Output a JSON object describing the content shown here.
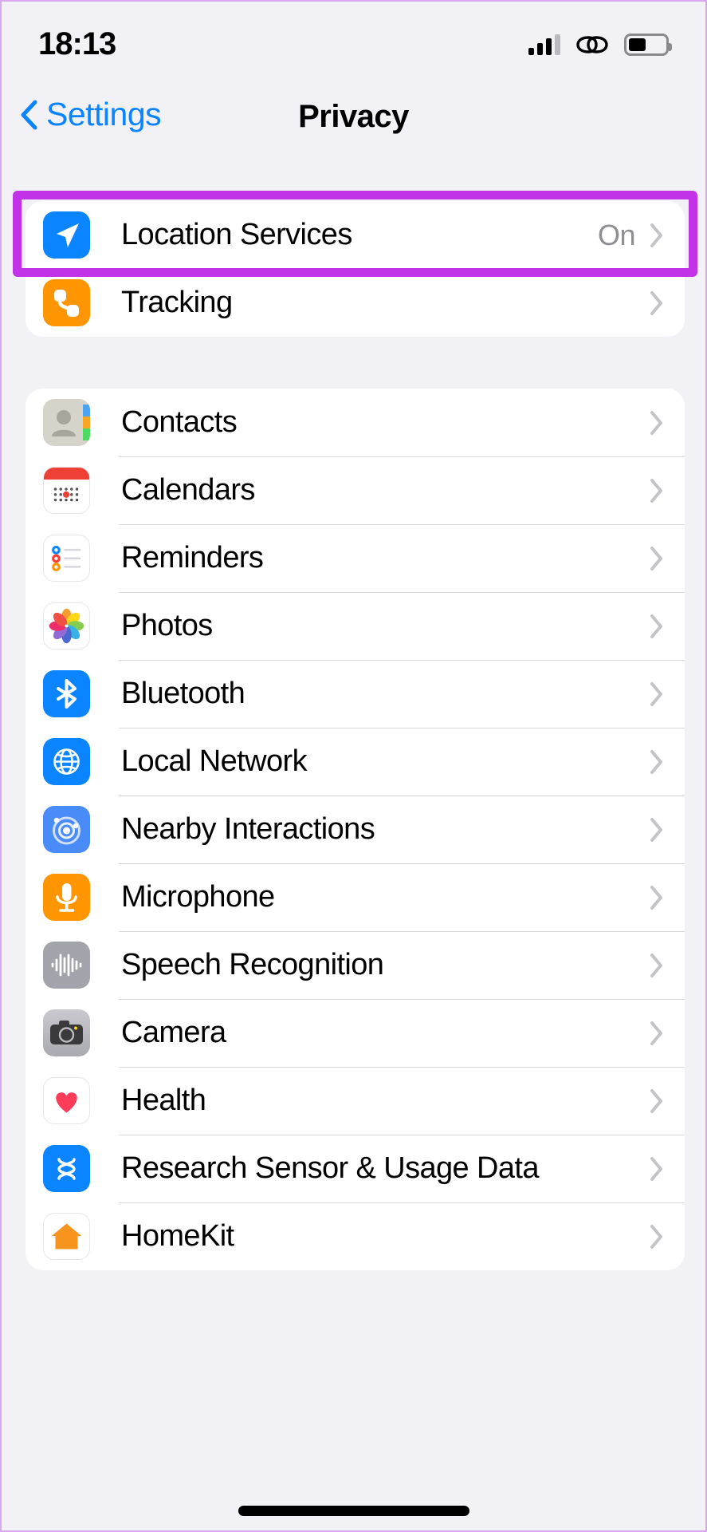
{
  "status_bar": {
    "time": "18:13",
    "signal_icon": "cellular-signal-icon",
    "link_icon": "chain-link-icon",
    "battery_icon": "battery-icon",
    "battery_level_pct": 48
  },
  "nav": {
    "back_label": "Settings",
    "back_icon": "chevron-left-icon",
    "title": "Privacy"
  },
  "colors": {
    "accent_blue": "#0a84ff",
    "highlight_purple": "#c233e8",
    "background": "#f2f1f6",
    "card": "#ffffff",
    "value_gray": "#8e8e93",
    "orange": "#ff9500"
  },
  "groups": [
    {
      "name": "primary",
      "rows": [
        {
          "label": "Location Services",
          "value": "On",
          "icon": "location-arrow-icon",
          "highlighted": true
        },
        {
          "label": "Tracking",
          "value": "",
          "icon": "tracking-icon",
          "highlighted": false
        }
      ]
    },
    {
      "name": "permissions",
      "rows": [
        {
          "label": "Contacts",
          "value": "",
          "icon": "contacts-icon",
          "highlighted": false
        },
        {
          "label": "Calendars",
          "value": "",
          "icon": "calendar-icon",
          "highlighted": false
        },
        {
          "label": "Reminders",
          "value": "",
          "icon": "reminders-icon",
          "highlighted": false
        },
        {
          "label": "Photos",
          "value": "",
          "icon": "photos-icon",
          "highlighted": false
        },
        {
          "label": "Bluetooth",
          "value": "",
          "icon": "bluetooth-icon",
          "highlighted": false
        },
        {
          "label": "Local Network",
          "value": "",
          "icon": "globe-icon",
          "highlighted": false
        },
        {
          "label": "Nearby Interactions",
          "value": "",
          "icon": "nearby-interactions-icon",
          "highlighted": false
        },
        {
          "label": "Microphone",
          "value": "",
          "icon": "microphone-icon",
          "highlighted": false
        },
        {
          "label": "Speech Recognition",
          "value": "",
          "icon": "waveform-icon",
          "highlighted": false
        },
        {
          "label": "Camera",
          "value": "",
          "icon": "camera-icon",
          "highlighted": false
        },
        {
          "label": "Health",
          "value": "",
          "icon": "heart-icon",
          "highlighted": false
        },
        {
          "label": "Research Sensor & Usage Data",
          "value": "",
          "icon": "research-sensor-icon",
          "highlighted": false
        },
        {
          "label": "HomeKit",
          "value": "",
          "icon": "homekit-icon",
          "highlighted": false
        }
      ]
    }
  ],
  "home_indicator": "home-indicator"
}
